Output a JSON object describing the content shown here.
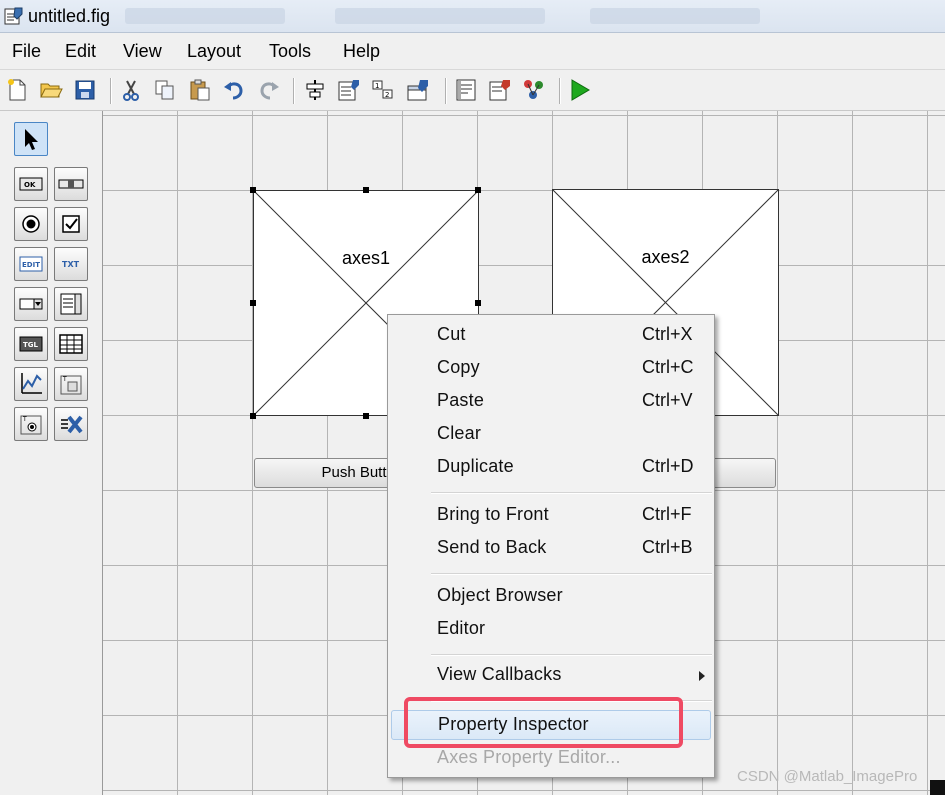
{
  "window": {
    "title": "untitled.fig"
  },
  "menu": [
    "File",
    "Edit",
    "View",
    "Layout",
    "Tools",
    "Help"
  ],
  "axes": [
    {
      "label": "axes1",
      "selected": true
    },
    {
      "label": "axes2",
      "selected": false
    }
  ],
  "buttons": {
    "push_button": "Push Butt"
  },
  "context_menu": {
    "items": [
      {
        "label": "Cut",
        "shortcut": "Ctrl+X"
      },
      {
        "label": "Copy",
        "shortcut": "Ctrl+C"
      },
      {
        "label": "Paste",
        "shortcut": "Ctrl+V"
      },
      {
        "label": "Clear",
        "shortcut": ""
      },
      {
        "label": "Duplicate",
        "shortcut": "Ctrl+D"
      },
      {
        "label": "Bring to Front",
        "shortcut": "Ctrl+F"
      },
      {
        "label": "Send to Back",
        "shortcut": "Ctrl+B"
      },
      {
        "label": "Object Browser",
        "shortcut": ""
      },
      {
        "label": "Editor",
        "shortcut": ""
      },
      {
        "label": "View Callbacks",
        "shortcut": ""
      },
      {
        "label": "Property Inspector",
        "shortcut": ""
      },
      {
        "label": "Axes Property Editor...",
        "shortcut": "",
        "disabled": true
      }
    ]
  },
  "watermark": "CSDN @Matlab_ImagePro",
  "colors": {
    "highlight": "#ef4a63",
    "run_green": "#1ea81e",
    "selection_blue": "#4a86c5"
  },
  "icons": {
    "toolbar": [
      "new-file-icon",
      "open-folder-icon",
      "save-icon",
      "cut-icon",
      "copy-icon",
      "paste-icon",
      "undo-icon",
      "redo-icon",
      "align-icon",
      "menu-editor-icon",
      "tab-order-icon",
      "toolbar-editor-icon",
      "mfile-editor-icon",
      "property-inspector-icon",
      "object-browser-icon",
      "run-icon"
    ],
    "palette": [
      "select-arrow-icon",
      "pushbutton-icon",
      "slider-icon",
      "radiobutton-icon",
      "checkbox-icon",
      "edit-text-icon",
      "static-text-icon",
      "popup-menu-icon",
      "listbox-icon",
      "toggle-button-icon",
      "table-icon",
      "axes-icon",
      "panel-icon",
      "button-group-icon",
      "activex-icon"
    ]
  }
}
